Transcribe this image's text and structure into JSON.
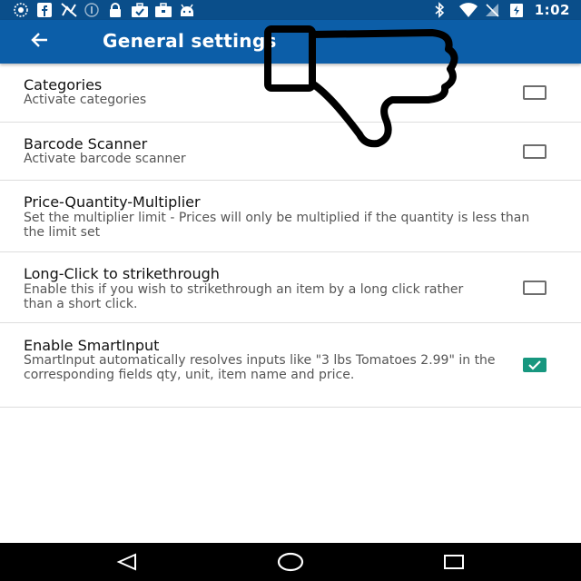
{
  "status_bar": {
    "time": "1:02",
    "left_icons": [
      "sync-icon",
      "facebook-icon",
      "no-signal-icon",
      "info-icon",
      "lock-icon",
      "briefcase-check-icon",
      "briefcase-icon",
      "android-icon"
    ],
    "right_icons": [
      "bluetooth-icon",
      "wifi-icon",
      "no-sim-icon",
      "battery-charging-icon"
    ]
  },
  "toolbar": {
    "title": "General settings",
    "back_icon": "arrow-left-icon",
    "background": "#0c5ea8"
  },
  "settings": [
    {
      "title": "Categories",
      "subtitle": "Activate categories",
      "checked": false
    },
    {
      "title": "Barcode Scanner",
      "subtitle": "Activate barcode scanner",
      "checked": false
    },
    {
      "title": "Price-Quantity-Multiplier",
      "subtitle": "Set the multiplier limit - Prices will only be multiplied if the quantity is less than the limit set"
    },
    {
      "title": "Long-Click to strikethrough",
      "subtitle": "Enable this if you wish to strikethrough an item by a long click rather than a short click.",
      "checked": false
    },
    {
      "title": "Enable SmartInput",
      "subtitle": "SmartInput automatically resolves inputs like \"3 lbs Tomatoes 2.99\" in the corresponding fields qty, unit, item name and price.",
      "checked": true
    }
  ],
  "colors": {
    "accent": "#17977f",
    "statusbar": "#0a4e8a"
  },
  "overlay_icon": "thumbs-down-icon",
  "nav_bar": {
    "icons": [
      "back-triangle-icon",
      "home-circle-icon",
      "recents-square-icon"
    ]
  }
}
